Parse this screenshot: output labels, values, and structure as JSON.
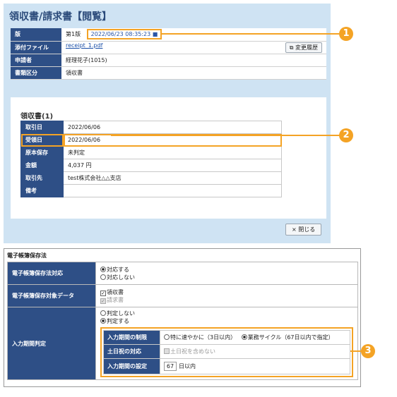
{
  "top_panel": {
    "title": "領収書/請求書【閲覧】",
    "rows": [
      {
        "label": "版",
        "value": "第1版",
        "timestamp": "2022/06/23 08:35:23",
        "lock": "🔒"
      },
      {
        "label": "添付ファイル",
        "value": "receipt_1.pdf",
        "button": "変更履歴"
      },
      {
        "label": "申請者",
        "value": "経理花子(1015)"
      },
      {
        "label": "書類区分",
        "value": "領収書"
      }
    ],
    "card": {
      "title": "領収書(1)",
      "rows": [
        {
          "label": "取引日",
          "value": "2022/06/06"
        },
        {
          "label": "受領日",
          "value": "2022/06/06"
        },
        {
          "label": "原本保存",
          "value": "未判定"
        },
        {
          "label": "金額",
          "value": "4,037 円"
        },
        {
          "label": "取引先",
          "value": "test株式会社△△支店"
        },
        {
          "label": "備考",
          "value": ""
        }
      ]
    },
    "close_button": "閉じる",
    "close_icon": "×"
  },
  "callouts": [
    "1",
    "2",
    "3"
  ],
  "law": {
    "title": "電子帳簿保存法",
    "compliance": {
      "label": "電子帳簿保存法対応",
      "options": [
        "対応する",
        "対応しない"
      ],
      "selected": 0
    },
    "target": {
      "label": "電子帳簿保存対象データ",
      "options": [
        "領収書",
        "請求書"
      ]
    },
    "deadline": {
      "label": "入力期間判定",
      "options": [
        "判定しない",
        "判定する"
      ],
      "selected": 1,
      "limit_label": "入力期間の制限",
      "limit_options": [
        "特に速やかに（3日以内）",
        "業務サイクル（67日以内で指定）"
      ],
      "weekend_label": "土日祝の対応",
      "weekend_option": "土日祝を含めない",
      "setting_label": "入力期間の設定",
      "setting_value": "67",
      "setting_unit": "日以内"
    }
  },
  "colors": {
    "accent": "#f4a325",
    "header_blue": "#2e4f86",
    "panel_bg": "#cfe3f3"
  }
}
